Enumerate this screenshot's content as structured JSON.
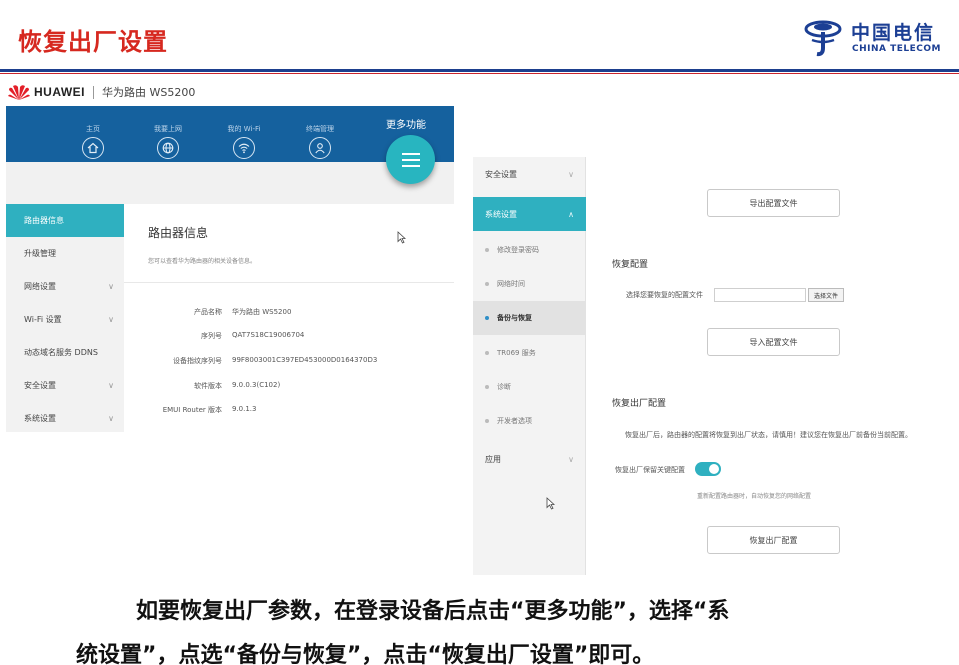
{
  "slide": {
    "title": "恢复出厂设置",
    "logo_cn": "中国电信",
    "logo_en": "CHINA TELECOM",
    "brand_color": "#1d3f8e",
    "title_color": "#d6281f"
  },
  "huawei": {
    "brand": "HUAWEI",
    "product": "华为路由 WS5200"
  },
  "router_ui": {
    "nav": [
      {
        "label": "主页",
        "icon": "home-icon"
      },
      {
        "label": "我要上网",
        "icon": "globe-icon"
      },
      {
        "label": "我的 Wi-Fi",
        "icon": "wifi-icon"
      },
      {
        "label": "终端管理",
        "icon": "user-icon"
      }
    ],
    "more_label": "更多功能",
    "sidebar": [
      {
        "label": "路由器信息",
        "active": true,
        "chevron": false
      },
      {
        "label": "升级管理",
        "active": false,
        "chevron": false
      },
      {
        "label": "网络设置",
        "active": false,
        "chevron": true
      },
      {
        "label": "Wi-Fi 设置",
        "active": false,
        "chevron": true
      },
      {
        "label": "动态域名服务 DDNS",
        "active": false,
        "chevron": false
      },
      {
        "label": "安全设置",
        "active": false,
        "chevron": true
      },
      {
        "label": "系统设置",
        "active": false,
        "chevron": true
      }
    ],
    "content": {
      "title": "路由器信息",
      "desc": "您可以查看华为路由器的相关设备信息。",
      "rows": [
        {
          "key": "产品名称",
          "value": "华为路由 WS5200"
        },
        {
          "key": "序列号",
          "value": "QAT7S18C19006704"
        },
        {
          "key": "设备指纹序列号",
          "value": "99F8003001C397ED453000D0164370D3"
        },
        {
          "key": "软件版本",
          "value": "9.0.0.3(C102)"
        },
        {
          "key": "EMUI Router 版本",
          "value": "9.0.1.3"
        }
      ]
    }
  },
  "system_ui": {
    "sidebar": {
      "security": "安全设置",
      "system": "系统设置",
      "subitems": [
        {
          "label": "修改登录密码",
          "selected": false
        },
        {
          "label": "网络时间",
          "selected": false
        },
        {
          "label": "备份与恢复",
          "selected": true
        },
        {
          "label": "TR069 服务",
          "selected": false
        },
        {
          "label": "诊断",
          "selected": false
        },
        {
          "label": "开发者选项",
          "selected": false
        }
      ],
      "apps": "应用"
    },
    "export_button": "导出配置文件",
    "restore_title": "恢复配置",
    "choose_file_label": "选择您要恢复的配置文件",
    "file_input_value": "",
    "browse_button": "选择文件",
    "import_button": "导入配置文件",
    "factory_title": "恢复出厂配置",
    "factory_desc": "恢复出厂后，路由器的配置将恢复到出厂状态，请慎用！建议您在恢复出厂前备份当前配置。",
    "keep_key_config_label": "恢复出厂保留关键配置",
    "keep_key_config_on": true,
    "keep_key_config_note": "重新配置路由器时，自动恢复您的网络配置",
    "factory_button": "恢复出厂配置"
  },
  "caption": {
    "line1": "如要恢复出厂参数，在登录设备后点击“更多功能”，选择“系",
    "line2": "统设置”，点选“备份与恢复”，点击“恢复出厂设置”即可。"
  }
}
